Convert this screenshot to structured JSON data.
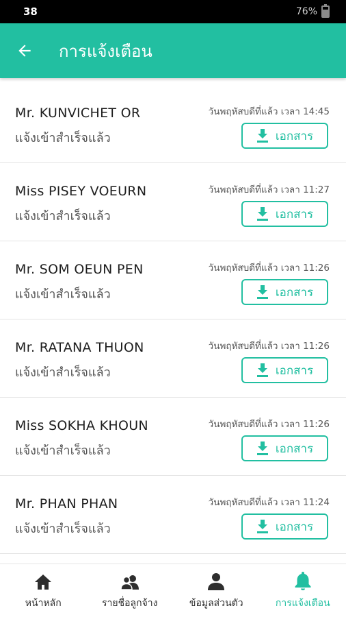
{
  "status_bar": {
    "time": "38",
    "battery": "76%"
  },
  "app_bar": {
    "title": "การแจ้งเตือน",
    "back_icon": "arrow-left-icon"
  },
  "colors": {
    "accent": "#22bfa1",
    "status_bar": "#000000"
  },
  "notifications": [
    {
      "name": "Mr. KUNVICHET OR",
      "status": "แจ้งเข้าสำเร็จแล้ว",
      "time": "วันพฤหัสบดีที่แล้ว เวลา 14:45",
      "button": "เอกสาร"
    },
    {
      "name": "Miss PISEY VOEURN",
      "status": "แจ้งเข้าสำเร็จแล้ว",
      "time": "วันพฤหัสบดีที่แล้ว เวลา 11:27",
      "button": "เอกสาร"
    },
    {
      "name": "Mr. SOM OEUN PEN",
      "status": "แจ้งเข้าสำเร็จแล้ว",
      "time": "วันพฤหัสบดีที่แล้ว เวลา 11:26",
      "button": "เอกสาร"
    },
    {
      "name": "Mr. RATANA THUON",
      "status": "แจ้งเข้าสำเร็จแล้ว",
      "time": "วันพฤหัสบดีที่แล้ว เวลา 11:26",
      "button": "เอกสาร"
    },
    {
      "name": "Miss SOKHA KHOUN",
      "status": "แจ้งเข้าสำเร็จแล้ว",
      "time": "วันพฤหัสบดีที่แล้ว เวลา 11:26",
      "button": "เอกสาร"
    },
    {
      "name": "Mr. PHAN PHAN",
      "status": "แจ้งเข้าสำเร็จแล้ว",
      "time": "วันพฤหัสบดีที่แล้ว เวลา 11:24",
      "button": "เอกสาร"
    }
  ],
  "bottom_nav": [
    {
      "label": "หน้าหลัก",
      "icon": "home-icon",
      "active": false
    },
    {
      "label": "รายชื่อลูกจ้าง",
      "icon": "employees-icon",
      "active": false
    },
    {
      "label": "ข้อมูลส่วนตัว",
      "icon": "person-icon",
      "active": false
    },
    {
      "label": "การแจ้งเตือน",
      "icon": "bell-icon",
      "active": true
    }
  ]
}
